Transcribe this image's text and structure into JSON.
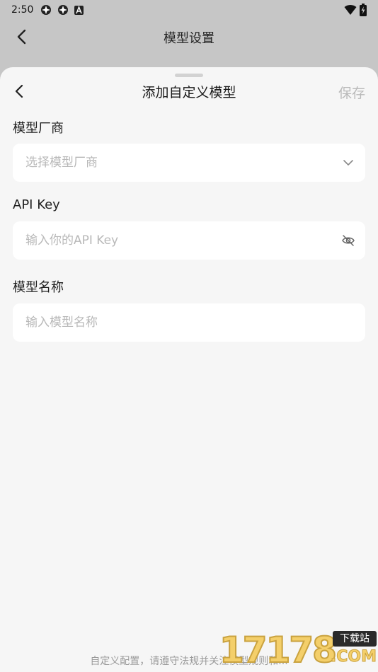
{
  "status_bar": {
    "time": "2:50",
    "left_icons": [
      "gear-like-app-icon",
      "gear-like-app-icon",
      "a-square-icon"
    ],
    "right_icons": [
      "wifi-icon",
      "battery-charging-icon"
    ]
  },
  "background_page": {
    "title": "模型设置"
  },
  "sheet": {
    "title": "添加自定义模型",
    "save_label": "保存",
    "fields": [
      {
        "label": "模型厂商",
        "placeholder": "选择模型厂商",
        "value": "",
        "icon": "chevron-down-icon"
      },
      {
        "label": "API Key",
        "placeholder": "输入你的API Key",
        "value": "",
        "icon": "eye-off-icon"
      },
      {
        "label": "模型名称",
        "placeholder": "输入模型名称",
        "value": ""
      }
    ],
    "footer_note": "自定义配置，请遵守法规并关注模型规则和..."
  },
  "watermark": {
    "digits": "17178",
    "badge": "下载站",
    "domain": ".COM"
  },
  "colors": {
    "overlay": "#c6c6c6",
    "sheet": "#f6f6f6",
    "input": "#ffffff",
    "placeholder": "#b8b8b8",
    "save_disabled": "#b9b9b9"
  }
}
